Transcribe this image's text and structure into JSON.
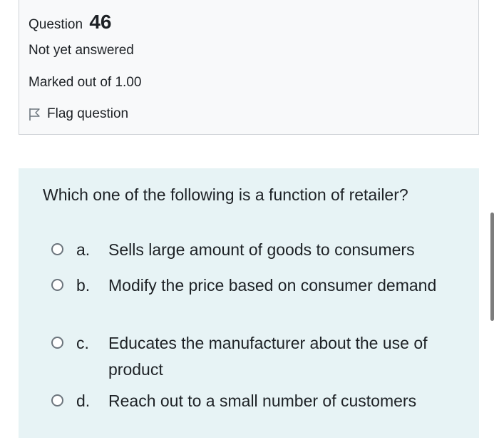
{
  "question": {
    "label": "Question",
    "number": "46",
    "state": "Not yet answered",
    "grade": "Marked out of 1.00",
    "flag_label": "Flag question"
  },
  "content": {
    "question_text": "Which one of the following is a function of retailer?",
    "answers": [
      {
        "letter": "a.",
        "text": "Sells large amount of goods to consumers"
      },
      {
        "letter": "b.",
        "text": "Modify the price based on consumer demand"
      },
      {
        "letter": "c.",
        "text": "Educates the manufacturer about the use of product"
      },
      {
        "letter": "d.",
        "text": "Reach out to a small number of customers"
      }
    ]
  },
  "colors": {
    "info_bg": "#f8f9fa",
    "content_bg": "#e7f3f5",
    "text": "#1d2125"
  }
}
